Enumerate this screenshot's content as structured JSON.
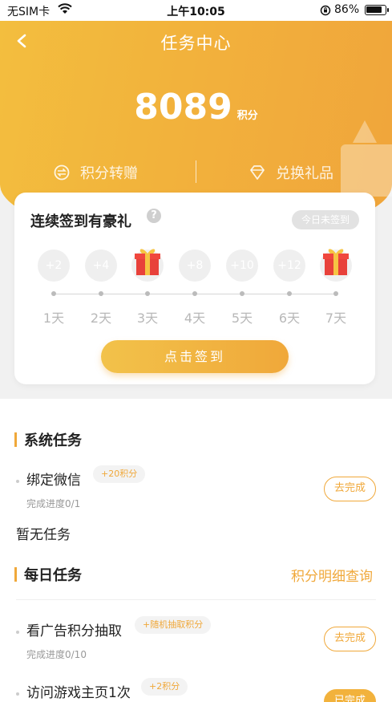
{
  "status_bar": {
    "carrier": "无SIM卡",
    "time": "上午10:05",
    "battery": "86%"
  },
  "nav": {
    "title": "任务中心"
  },
  "points": {
    "value": "8089",
    "unit": "积分"
  },
  "actions": {
    "transfer": "积分转赠",
    "exchange": "兑换礼品"
  },
  "sign_in": {
    "title": "连续签到有豪礼",
    "help": "?",
    "status": "今日未签到",
    "days": [
      {
        "label": "1天",
        "reward": "+2",
        "gift": false
      },
      {
        "label": "2天",
        "reward": "+4",
        "gift": false
      },
      {
        "label": "3天",
        "reward": "",
        "gift": true
      },
      {
        "label": "4天",
        "reward": "+8",
        "gift": false
      },
      {
        "label": "5天",
        "reward": "+10",
        "gift": false
      },
      {
        "label": "6天",
        "reward": "+12",
        "gift": false
      },
      {
        "label": "7天",
        "reward": "",
        "gift": true
      }
    ],
    "button": "点击签到"
  },
  "system_tasks": {
    "title": "系统任务",
    "items": [
      {
        "name": "绑定微信",
        "reward": "+20积分",
        "progress": "完成进度0/1",
        "action": "去完成"
      }
    ],
    "empty": "暂无任务"
  },
  "daily_tasks": {
    "title": "每日任务",
    "detail_link": "积分明细查询",
    "items": [
      {
        "name": "看广告积分抽取",
        "reward": "+随机抽取积分",
        "progress": "完成进度0/10",
        "action": "去完成"
      },
      {
        "name": "访问游戏主页1次",
        "reward": "+2积分",
        "progress": "",
        "action": "已完成"
      }
    ]
  },
  "colors": {
    "accent": "#f0a83a",
    "header": "#f2b23c",
    "grey_text": "#b8b8b8"
  }
}
